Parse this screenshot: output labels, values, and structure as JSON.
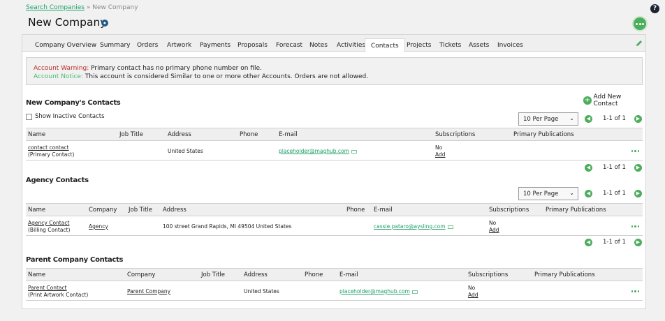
{
  "breadcrumb": {
    "search_link": "Search Companies",
    "separator": " » ",
    "current": "New Company"
  },
  "page": {
    "title": "New Company",
    "help": "?"
  },
  "tabs": [
    "Company Overview",
    "Summary",
    "Orders",
    "Artwork",
    "Payments",
    "Proposals",
    "Forecast",
    "Notes",
    "Activities",
    "Contacts",
    "Projects",
    "Tickets",
    "Assets",
    "Invoices"
  ],
  "active_tab": "Contacts",
  "alert": {
    "warning_label": "Account Warning:",
    "warning_text": " Primary contact has no primary phone number on file.",
    "notice_label": "Account Notice:",
    "notice_text": " This account is considered Similar to one or more other Accounts. Orders are not allowed."
  },
  "contacts_section": {
    "title": "New Company's Contacts",
    "add_label": "Add New Contact",
    "show_inactive_label": "Show Inactive Contacts",
    "per_page": "10 Per Page",
    "pagination": "1-1 of 1",
    "columns": [
      "Name",
      "Job Title",
      "Address",
      "Phone",
      "E-mail",
      "Subscriptions",
      "Primary Publications"
    ],
    "rows": [
      {
        "name": "contact contact",
        "role": "(Primary Contact)",
        "job_title": "",
        "address": "United States",
        "phone": "",
        "email": "placeholder@maghub.com",
        "subscription": "No",
        "sub_action": "Add"
      }
    ],
    "pagination_bottom": "1-1 of 1"
  },
  "agency_section": {
    "title": "Agency Contacts",
    "per_page": "10 Per Page",
    "pagination": "1-1 of 1",
    "columns": [
      "Name",
      "Company",
      "Job Title",
      "Address",
      "Phone",
      "E-mail",
      "Subscriptions",
      "Primary Publications"
    ],
    "rows": [
      {
        "name": "Agency Contact",
        "role": "(Billing Contact)",
        "company": "Agency",
        "job_title": "",
        "address": "100 street Grand Rapids, MI 49504 United States",
        "phone": "",
        "email": "cassie.pataro@aysling.com",
        "subscription": "No",
        "sub_action": "Add"
      }
    ],
    "pagination_bottom": "1-1 of 1"
  },
  "parent_section": {
    "title": "Parent Company Contacts",
    "columns": [
      "Name",
      "Company",
      "Job Title",
      "Address",
      "Phone",
      "E-mail",
      "Subscriptions",
      "Primary Publications"
    ],
    "rows": [
      {
        "name": "Parent Contact",
        "role": "(Print Artwork Contact)",
        "company": "Parent Company",
        "job_title": "",
        "address": "United States",
        "phone": "",
        "email": "placeholder@maghub.com",
        "subscription": "No",
        "sub_action": "Add"
      }
    ]
  },
  "colors": {
    "accent": "#4cae5c",
    "link": "#1e9f6b",
    "warning": "#b92b27",
    "notice": "#48b96d"
  },
  "icons": {
    "help": "help-icon",
    "more": "more-options-icon",
    "edit": "pencil-icon",
    "add": "plus-circle-icon",
    "prev": "chevron-left-icon",
    "next": "chevron-right-icon",
    "mail": "mail-icon"
  }
}
